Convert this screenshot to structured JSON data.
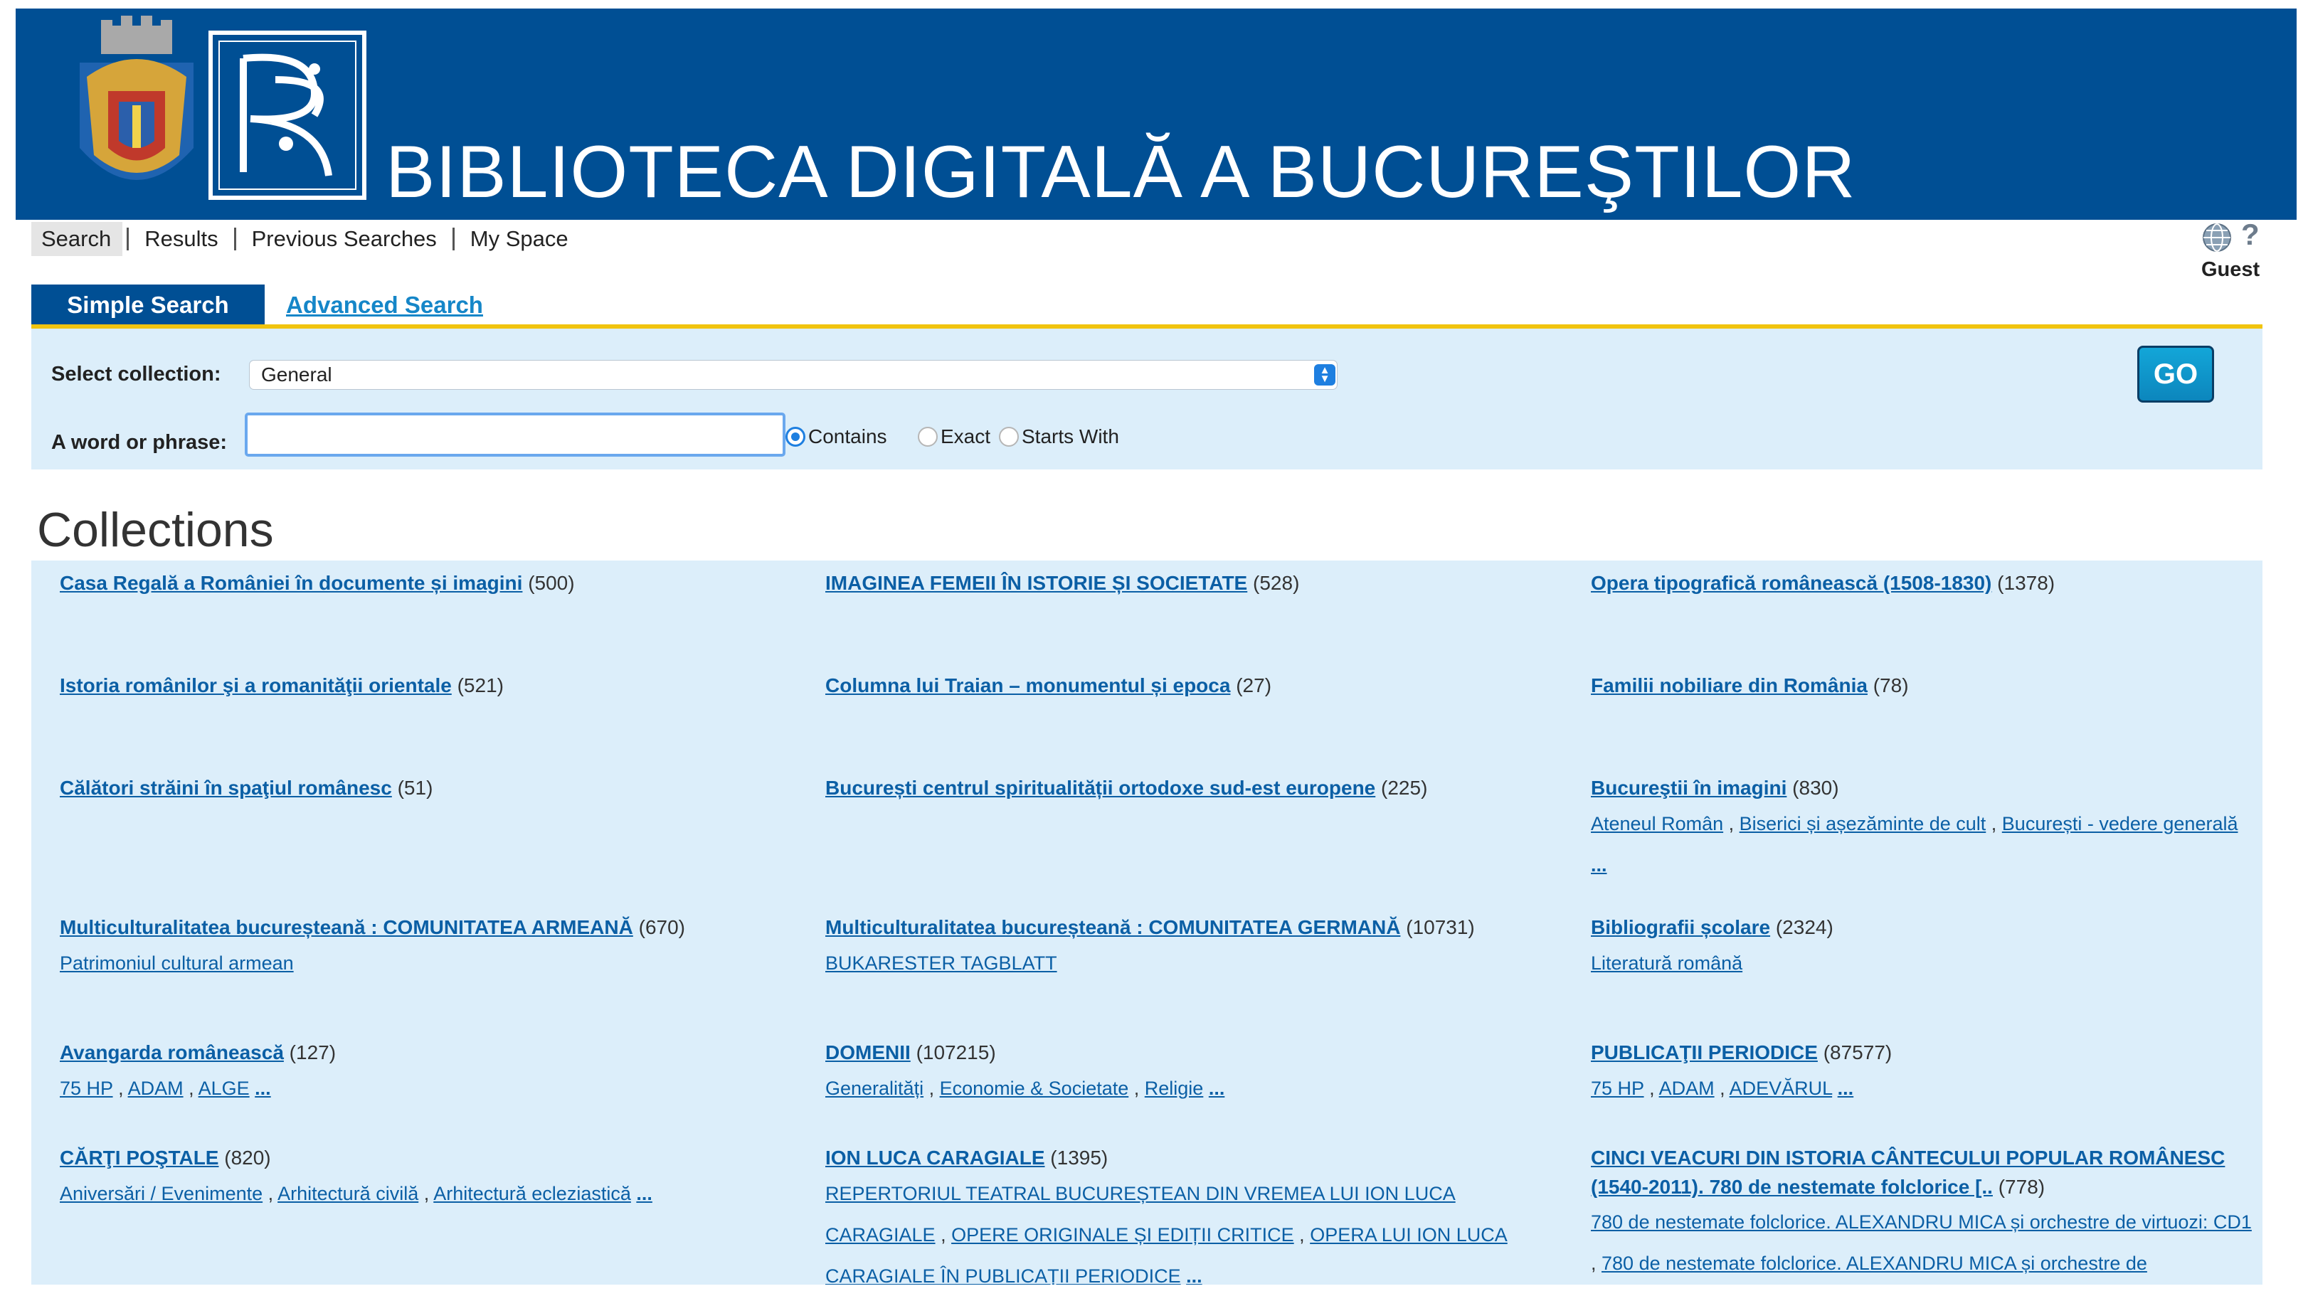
{
  "banner": {
    "title": "BIBLIOTECA DIGITALĂ A BUCUREŞTILOR"
  },
  "nav": {
    "items": [
      "Search",
      "Results",
      "Previous Searches",
      "My Space"
    ],
    "help": "?",
    "user": "Guest"
  },
  "tabs": {
    "simple": "Simple Search",
    "advanced": "Advanced Search"
  },
  "search": {
    "collection_label": "Select collection:",
    "collection_value": "General",
    "phrase_label": "A word or phrase:",
    "phrase_value": "",
    "options": [
      "Contains",
      "Exact",
      "Starts With"
    ],
    "selected_option": "Contains",
    "go": "GO"
  },
  "collections": {
    "title": "Collections",
    "items": [
      {
        "name": "Casa Regală a României în documente și imagini",
        "count": "(500)",
        "subs": []
      },
      {
        "name": "IMAGINEA FEMEII ÎN ISTORIE ȘI SOCIETATE",
        "count": "(528)",
        "subs": []
      },
      {
        "name": "Opera tipografică românească (1508-1830)",
        "count": "(1378)",
        "subs": []
      },
      {
        "name": "Istoria românilor şi a romanităţii orientale",
        "count": "(521)",
        "subs": []
      },
      {
        "name": "Columna lui Traian – monumentul și epoca",
        "count": "(27)",
        "subs": []
      },
      {
        "name": "Familii nobiliare din România",
        "count": "(78)",
        "subs": []
      },
      {
        "name": "Călători străini în spaţiul românesc",
        "count": "(51)",
        "subs": []
      },
      {
        "name": "București centrul spiritualității ortodoxe sud-est europene",
        "count": "(225)",
        "subs": []
      },
      {
        "name": "Bucureştii în imagini",
        "count": "(830)",
        "subs": [
          "Ateneul Român",
          "Biserici și așezăminte de cult",
          "București - vedere generală"
        ],
        "more": "..."
      },
      {
        "name": "Multiculturalitatea bucureșteană : COMUNITATEA ARMEANĂ",
        "count": "(670)",
        "subs": [
          "Patrimoniul cultural armean"
        ]
      },
      {
        "name": "Multiculturalitatea bucureșteană : COMUNITATEA GERMANĂ",
        "count": "(10731)",
        "subs": [
          "BUKARESTER TAGBLATT"
        ]
      },
      {
        "name": "Bibliografii școlare",
        "count": "(2324)",
        "subs": [
          "Literatură română"
        ]
      },
      {
        "name": "Avangarda românească",
        "count": "(127)",
        "subs": [
          "75 HP",
          "ADAM",
          "ALGE"
        ],
        "more": "..."
      },
      {
        "name": "DOMENII",
        "count": "(107215)",
        "subs": [
          "Generalități",
          "Economie & Societate",
          "Religie"
        ],
        "more": "..."
      },
      {
        "name": "PUBLICAŢII PERIODICE",
        "count": "(87577)",
        "subs": [
          "75 HP",
          "ADAM",
          "ADEVĂRUL"
        ],
        "more": "..."
      },
      {
        "name": "CĂRŢI POŞTALE",
        "count": "(820)",
        "subs": [
          "Aniversări / Evenimente",
          "Arhitectură civilă",
          "Arhitectură ecleziastică"
        ],
        "more": "..."
      },
      {
        "name": "ION LUCA CARAGIALE",
        "count": "(1395)",
        "subs": [
          "REPERTORIUL TEATRAL BUCUREȘTEAN DIN VREMEA LUI ION LUCA CARAGIALE",
          "OPERE ORIGINALE ȘI EDIȚII CRITICE",
          "OPERA LUI ION LUCA CARAGIALE ÎN PUBLICAȚII PERIODICE"
        ],
        "more": "..."
      },
      {
        "name": "CINCI VEACURI DIN ISTORIA CÂNTECULUI POPULAR ROMÂNESC (1540-2011). 780 de nestemate folclorice [..",
        "count": "(778)",
        "subs": [
          "780 de nestemate folclorice. ALEXANDRU MICA și orchestre de virtuozi: CD1",
          "780 de nestemate folclorice. ALEXANDRU MICA și orchestre de"
        ]
      }
    ]
  }
}
